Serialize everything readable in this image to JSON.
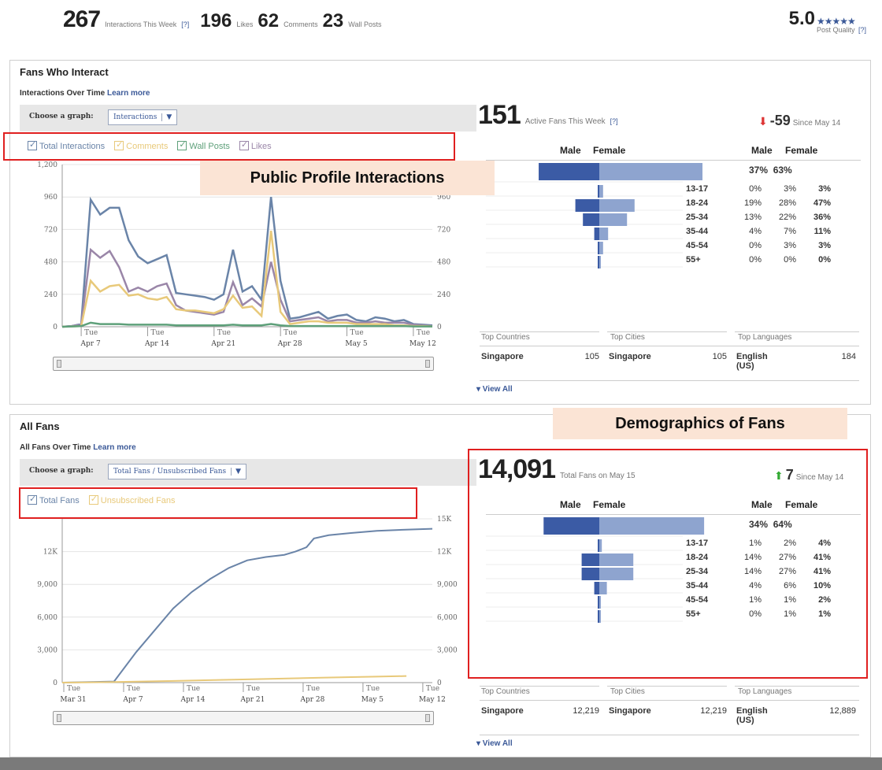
{
  "top": {
    "interactions": "267",
    "interactions_label": "Interactions This Week",
    "help": "[?]",
    "likes": "196",
    "likes_label": "Likes",
    "comments": "62",
    "comments_label": "Comments",
    "wall_posts": "23",
    "wall_posts_label": "Wall Posts",
    "quality": "5.0",
    "quality_label": "Post Quality",
    "quality_stars": 5
  },
  "panel1": {
    "title": "Fans Who Interact",
    "subtitle": "Interactions Over Time",
    "learn_more": "Learn more",
    "choose_label": "Choose a graph:",
    "select_value": "Interactions",
    "legend": [
      "Total Interactions",
      "Comments",
      "Wall Posts",
      "Likes"
    ],
    "legend_colors": [
      "#6a84a8",
      "#e8c97a",
      "#5ea07a",
      "#9a86a8"
    ],
    "callout": "Public Profile  Interactions",
    "active_num": "151",
    "active_label": "Active Fans This Week",
    "active_help": "[?]",
    "delta": "-59",
    "delta_label": "Since May 14",
    "male": "Male",
    "female": "Female",
    "male_total": "37%",
    "female_total": "63%",
    "rows": [
      {
        "age": "13-17",
        "m": "0%",
        "f": "3%",
        "t": "3%"
      },
      {
        "age": "18-24",
        "m": "19%",
        "f": "28%",
        "t": "47%"
      },
      {
        "age": "25-34",
        "m": "13%",
        "f": "22%",
        "t": "36%"
      },
      {
        "age": "35-44",
        "m": "4%",
        "f": "7%",
        "t": "11%"
      },
      {
        "age": "45-54",
        "m": "0%",
        "f": "3%",
        "t": "3%"
      },
      {
        "age": "55+",
        "m": "0%",
        "f": "0%",
        "t": "0%"
      }
    ],
    "top_countries": "Top Countries",
    "top_cities": "Top Cities",
    "top_languages": "Top Languages",
    "country": "Singapore",
    "country_val": "105",
    "city": "Singapore",
    "city_val": "105",
    "language": "English (US)",
    "language_val": "184",
    "view_all": "▾ View All"
  },
  "panel2": {
    "title": "All Fans",
    "subtitle": "All Fans Over Time",
    "learn_more": "Learn more",
    "choose_label": "Choose a graph:",
    "select_value": "Total Fans / Unsubscribed Fans",
    "legend": [
      "Total Fans",
      "Unsubscribed Fans"
    ],
    "legend_colors": [
      "#6a84a8",
      "#e8c97a"
    ],
    "callout": "Demographics of Fans",
    "total_num": "14,091",
    "total_label": "Total Fans on May 15",
    "delta": "7",
    "delta_label": "Since May 14",
    "male": "Male",
    "female": "Female",
    "male_total": "34%",
    "female_total": "64%",
    "rows": [
      {
        "age": "13-17",
        "m": "1%",
        "f": "2%",
        "t": "4%"
      },
      {
        "age": "18-24",
        "m": "14%",
        "f": "27%",
        "t": "41%"
      },
      {
        "age": "25-34",
        "m": "14%",
        "f": "27%",
        "t": "41%"
      },
      {
        "age": "35-44",
        "m": "4%",
        "f": "6%",
        "t": "10%"
      },
      {
        "age": "45-54",
        "m": "1%",
        "f": "1%",
        "t": "2%"
      },
      {
        "age": "55+",
        "m": "0%",
        "f": "1%",
        "t": "1%"
      }
    ],
    "top_countries": "Top Countries",
    "top_cities": "Top Cities",
    "top_languages": "Top Languages",
    "country": "Singapore",
    "country_val": "12,219",
    "city": "Singapore",
    "city_val": "12,219",
    "language": "English (US)",
    "language_val": "12,889",
    "view_all": "▾ View All"
  },
  "chart_data": [
    {
      "type": "line",
      "title": "Interactions Over Time",
      "x": [
        "Apr 5",
        "Apr 6",
        "Apr 7",
        "Apr 8",
        "Apr 9",
        "Apr 10",
        "Apr 11",
        "Apr 12",
        "Apr 13",
        "Apr 14",
        "Apr 15",
        "Apr 16",
        "Apr 17",
        "Apr 18",
        "Apr 19",
        "Apr 20",
        "Apr 21",
        "Apr 22",
        "Apr 23",
        "Apr 24",
        "Apr 25",
        "Apr 26",
        "Apr 27",
        "Apr 28",
        "Apr 29",
        "Apr 30",
        "May 1",
        "May 2",
        "May 3",
        "May 4",
        "May 5",
        "May 6",
        "May 7",
        "May 8",
        "May 9",
        "May 10",
        "May 11",
        "May 12",
        "May 13",
        "May 14"
      ],
      "x_ticks": [
        "Tue Apr 7",
        "Tue Apr 14",
        "Tue Apr 21",
        "Tue Apr 28",
        "Tue May 5",
        "Tue May 12"
      ],
      "ylim": [
        0,
        1200
      ],
      "y_ticks": [
        "0",
        "240",
        "480",
        "720",
        "960",
        "1,200"
      ],
      "y_ticks_right": [
        "0",
        "240",
        "480",
        "720",
        "960"
      ],
      "series": [
        {
          "name": "Total Interactions",
          "color": "#6a84a8",
          "values": [
            0,
            5,
            20,
            940,
            830,
            880,
            880,
            640,
            520,
            470,
            500,
            530,
            250,
            240,
            230,
            220,
            200,
            240,
            570,
            260,
            300,
            200,
            960,
            340,
            60,
            70,
            90,
            110,
            60,
            80,
            90,
            50,
            40,
            70,
            60,
            40,
            50,
            20,
            15,
            10
          ]
        },
        {
          "name": "Likes",
          "color": "#9a86a8",
          "values": [
            0,
            5,
            15,
            570,
            510,
            560,
            440,
            260,
            290,
            260,
            300,
            320,
            160,
            120,
            110,
            100,
            90,
            110,
            330,
            160,
            210,
            150,
            480,
            200,
            40,
            50,
            60,
            70,
            40,
            50,
            50,
            30,
            30,
            40,
            30,
            30,
            30,
            15,
            10,
            5
          ]
        },
        {
          "name": "Comments",
          "color": "#e8c97a",
          "values": [
            0,
            2,
            5,
            340,
            260,
            300,
            310,
            230,
            240,
            210,
            200,
            220,
            130,
            120,
            120,
            110,
            100,
            130,
            230,
            140,
            150,
            80,
            710,
            110,
            20,
            30,
            40,
            40,
            30,
            30,
            30,
            20,
            20,
            20,
            20,
            10,
            10,
            5,
            5,
            2
          ]
        },
        {
          "name": "Wall Posts",
          "color": "#5ea07a",
          "values": [
            0,
            2,
            5,
            30,
            20,
            20,
            20,
            15,
            15,
            15,
            15,
            15,
            10,
            10,
            10,
            10,
            10,
            10,
            15,
            10,
            10,
            10,
            20,
            10,
            5,
            5,
            5,
            5,
            5,
            5,
            5,
            5,
            5,
            5,
            5,
            5,
            5,
            2,
            2,
            2
          ]
        }
      ]
    },
    {
      "type": "line",
      "title": "All Fans Over Time",
      "x_ticks": [
        "Tue Mar 31",
        "Tue Apr 7",
        "Tue Apr 14",
        "Tue Apr 21",
        "Tue Apr 28",
        "Tue May 5",
        "Tue May 12"
      ],
      "ylim": [
        0,
        15000
      ],
      "y_ticks": [
        "0",
        "3,000",
        "6,000",
        "9,000",
        "12K"
      ],
      "y_ticks_right": [
        "0",
        "3,000",
        "6,000",
        "9,000",
        "12K",
        "15K"
      ],
      "series": [
        {
          "name": "Total Fans",
          "color": "#6a84a8",
          "points": [
            [
              0,
              0
            ],
            [
              0.14,
              100
            ],
            [
              0.2,
              2800
            ],
            [
              0.25,
              4800
            ],
            [
              0.3,
              6800
            ],
            [
              0.35,
              8300
            ],
            [
              0.4,
              9500
            ],
            [
              0.45,
              10500
            ],
            [
              0.5,
              11200
            ],
            [
              0.55,
              11500
            ],
            [
              0.6,
              11700
            ],
            [
              0.63,
              12000
            ],
            [
              0.66,
              12400
            ],
            [
              0.68,
              13200
            ],
            [
              0.72,
              13500
            ],
            [
              0.78,
              13700
            ],
            [
              0.85,
              13900
            ],
            [
              0.92,
              14000
            ],
            [
              1,
              14091
            ]
          ]
        },
        {
          "name": "Unsubscribed Fans",
          "color": "#e8c97a",
          "points": [
            [
              0,
              0
            ],
            [
              0.14,
              50
            ],
            [
              0.3,
              150
            ],
            [
              0.5,
              300
            ],
            [
              0.7,
              450
            ],
            [
              0.85,
              550
            ],
            [
              0.93,
              600
            ]
          ]
        }
      ]
    }
  ]
}
